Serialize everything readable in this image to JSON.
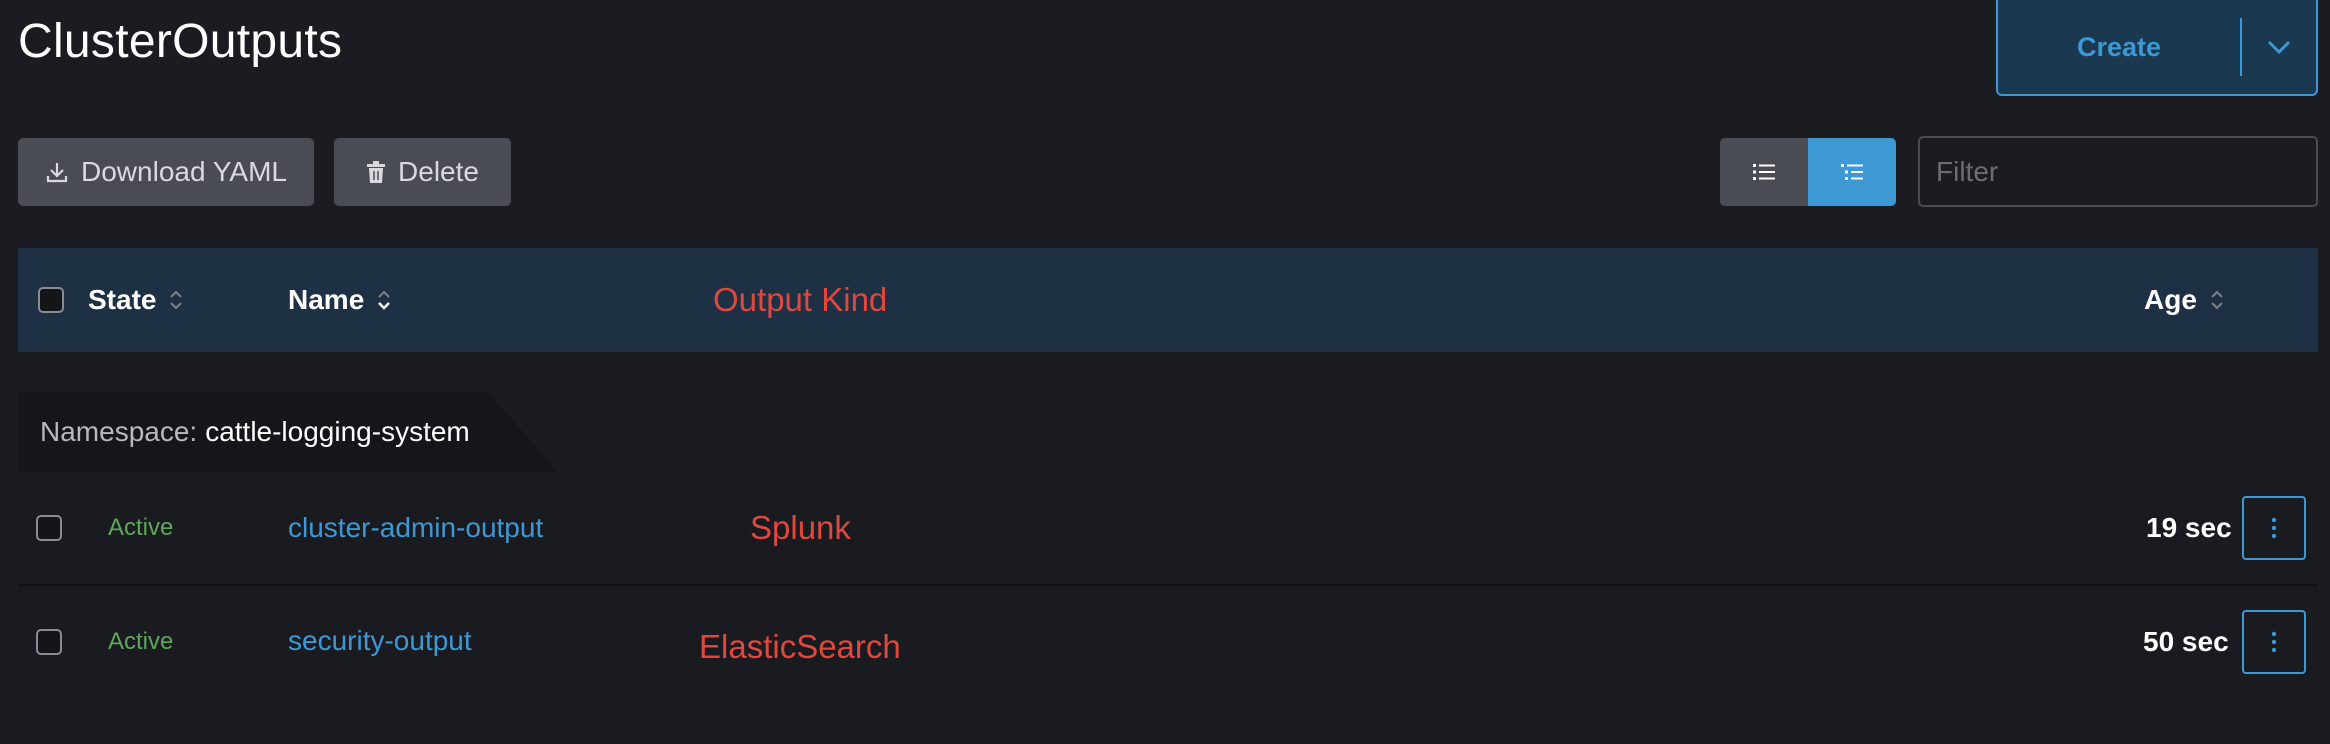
{
  "page": {
    "title": "ClusterOutputs"
  },
  "create": {
    "label": "Create"
  },
  "toolbar": {
    "download_label": "Download YAML",
    "delete_label": "Delete",
    "filter_placeholder": "Filter"
  },
  "table": {
    "columns": {
      "state": "State",
      "name": "Name",
      "output_kind": "Output Kind",
      "age": "Age"
    },
    "group": {
      "label": "Namespace:",
      "value": "cattle-logging-system"
    },
    "rows": [
      {
        "state": "Active",
        "name": "cluster-admin-output",
        "output_kind": "Splunk",
        "age": "19 sec"
      },
      {
        "state": "Active",
        "name": "security-output",
        "output_kind": "ElasticSearch",
        "age": "50 sec"
      }
    ]
  },
  "colors": {
    "background": "#1b1c21",
    "accent": "#3d98d3",
    "header": "#1e3043",
    "active": "#5ea65a",
    "annotation": "#e0483d"
  }
}
